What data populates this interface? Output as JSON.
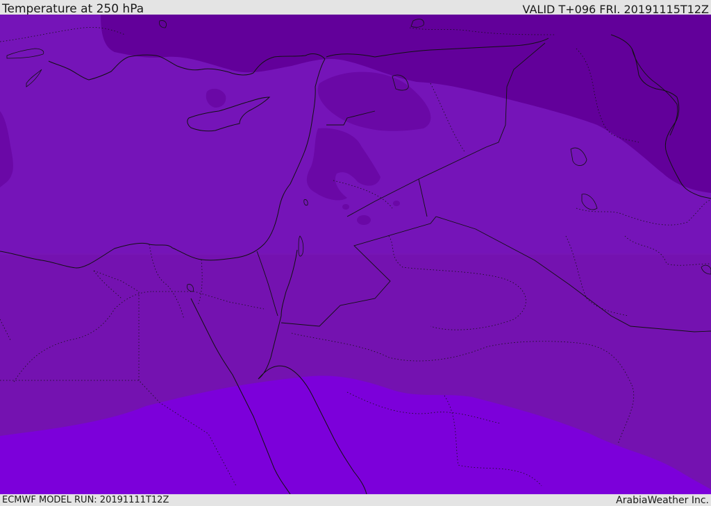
{
  "header": {
    "title": "Temperature at 250 hPa",
    "valid_time": "VALID T+096 FRI. 20191115T12Z"
  },
  "footer": {
    "model_run": "ECMWF MODEL RUN: 20191111T12Z",
    "credit": "ArabiaWeather Inc."
  },
  "colors": {
    "band_coldest": "#62009a",
    "band_cold": "#6e10a6",
    "band_mid": "#7514b8",
    "band_warm_mid": "#7412b0",
    "band_warm": "#7c00da",
    "coastline": "#111111",
    "borders": "#1a1a1a"
  }
}
